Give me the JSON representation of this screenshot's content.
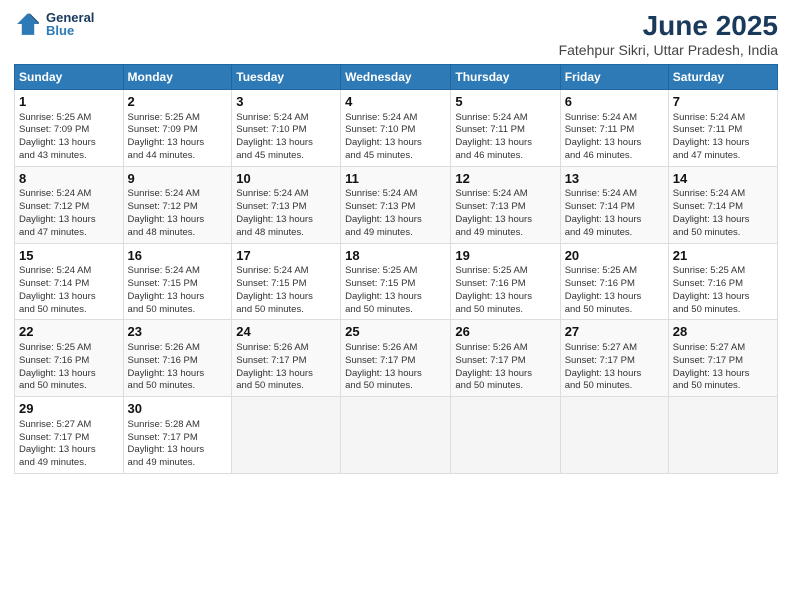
{
  "header": {
    "logo_line1": "General",
    "logo_line2": "Blue",
    "title": "June 2025",
    "subtitle": "Fatehpur Sikri, Uttar Pradesh, India"
  },
  "days_of_week": [
    "Sunday",
    "Monday",
    "Tuesday",
    "Wednesday",
    "Thursday",
    "Friday",
    "Saturday"
  ],
  "weeks": [
    [
      {
        "day": "1",
        "info": "Sunrise: 5:25 AM\nSunset: 7:09 PM\nDaylight: 13 hours\nand 43 minutes."
      },
      {
        "day": "2",
        "info": "Sunrise: 5:25 AM\nSunset: 7:09 PM\nDaylight: 13 hours\nand 44 minutes."
      },
      {
        "day": "3",
        "info": "Sunrise: 5:24 AM\nSunset: 7:10 PM\nDaylight: 13 hours\nand 45 minutes."
      },
      {
        "day": "4",
        "info": "Sunrise: 5:24 AM\nSunset: 7:10 PM\nDaylight: 13 hours\nand 45 minutes."
      },
      {
        "day": "5",
        "info": "Sunrise: 5:24 AM\nSunset: 7:11 PM\nDaylight: 13 hours\nand 46 minutes."
      },
      {
        "day": "6",
        "info": "Sunrise: 5:24 AM\nSunset: 7:11 PM\nDaylight: 13 hours\nand 46 minutes."
      },
      {
        "day": "7",
        "info": "Sunrise: 5:24 AM\nSunset: 7:11 PM\nDaylight: 13 hours\nand 47 minutes."
      }
    ],
    [
      {
        "day": "8",
        "info": "Sunrise: 5:24 AM\nSunset: 7:12 PM\nDaylight: 13 hours\nand 47 minutes."
      },
      {
        "day": "9",
        "info": "Sunrise: 5:24 AM\nSunset: 7:12 PM\nDaylight: 13 hours\nand 48 minutes."
      },
      {
        "day": "10",
        "info": "Sunrise: 5:24 AM\nSunset: 7:13 PM\nDaylight: 13 hours\nand 48 minutes."
      },
      {
        "day": "11",
        "info": "Sunrise: 5:24 AM\nSunset: 7:13 PM\nDaylight: 13 hours\nand 49 minutes."
      },
      {
        "day": "12",
        "info": "Sunrise: 5:24 AM\nSunset: 7:13 PM\nDaylight: 13 hours\nand 49 minutes."
      },
      {
        "day": "13",
        "info": "Sunrise: 5:24 AM\nSunset: 7:14 PM\nDaylight: 13 hours\nand 49 minutes."
      },
      {
        "day": "14",
        "info": "Sunrise: 5:24 AM\nSunset: 7:14 PM\nDaylight: 13 hours\nand 50 minutes."
      }
    ],
    [
      {
        "day": "15",
        "info": "Sunrise: 5:24 AM\nSunset: 7:14 PM\nDaylight: 13 hours\nand 50 minutes."
      },
      {
        "day": "16",
        "info": "Sunrise: 5:24 AM\nSunset: 7:15 PM\nDaylight: 13 hours\nand 50 minutes."
      },
      {
        "day": "17",
        "info": "Sunrise: 5:24 AM\nSunset: 7:15 PM\nDaylight: 13 hours\nand 50 minutes."
      },
      {
        "day": "18",
        "info": "Sunrise: 5:25 AM\nSunset: 7:15 PM\nDaylight: 13 hours\nand 50 minutes."
      },
      {
        "day": "19",
        "info": "Sunrise: 5:25 AM\nSunset: 7:16 PM\nDaylight: 13 hours\nand 50 minutes."
      },
      {
        "day": "20",
        "info": "Sunrise: 5:25 AM\nSunset: 7:16 PM\nDaylight: 13 hours\nand 50 minutes."
      },
      {
        "day": "21",
        "info": "Sunrise: 5:25 AM\nSunset: 7:16 PM\nDaylight: 13 hours\nand 50 minutes."
      }
    ],
    [
      {
        "day": "22",
        "info": "Sunrise: 5:25 AM\nSunset: 7:16 PM\nDaylight: 13 hours\nand 50 minutes."
      },
      {
        "day": "23",
        "info": "Sunrise: 5:26 AM\nSunset: 7:16 PM\nDaylight: 13 hours\nand 50 minutes."
      },
      {
        "day": "24",
        "info": "Sunrise: 5:26 AM\nSunset: 7:17 PM\nDaylight: 13 hours\nand 50 minutes."
      },
      {
        "day": "25",
        "info": "Sunrise: 5:26 AM\nSunset: 7:17 PM\nDaylight: 13 hours\nand 50 minutes."
      },
      {
        "day": "26",
        "info": "Sunrise: 5:26 AM\nSunset: 7:17 PM\nDaylight: 13 hours\nand 50 minutes."
      },
      {
        "day": "27",
        "info": "Sunrise: 5:27 AM\nSunset: 7:17 PM\nDaylight: 13 hours\nand 50 minutes."
      },
      {
        "day": "28",
        "info": "Sunrise: 5:27 AM\nSunset: 7:17 PM\nDaylight: 13 hours\nand 50 minutes."
      }
    ],
    [
      {
        "day": "29",
        "info": "Sunrise: 5:27 AM\nSunset: 7:17 PM\nDaylight: 13 hours\nand 49 minutes."
      },
      {
        "day": "30",
        "info": "Sunrise: 5:28 AM\nSunset: 7:17 PM\nDaylight: 13 hours\nand 49 minutes."
      },
      {
        "day": "",
        "info": ""
      },
      {
        "day": "",
        "info": ""
      },
      {
        "day": "",
        "info": ""
      },
      {
        "day": "",
        "info": ""
      },
      {
        "day": "",
        "info": ""
      }
    ]
  ]
}
